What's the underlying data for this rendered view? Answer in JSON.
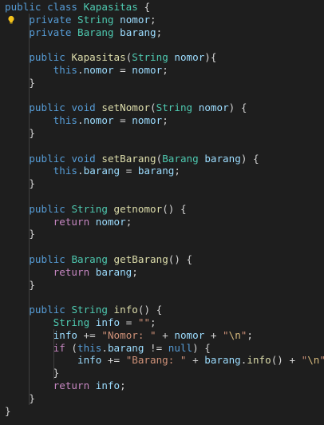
{
  "editor": {
    "background": "#1e1e1e",
    "lightbulb_icon": "lightbulb-icon",
    "lines": [
      [
        [
          "kw",
          "public"
        ],
        [
          "punc",
          " "
        ],
        [
          "kw",
          "class"
        ],
        [
          "punc",
          " "
        ],
        [
          "type",
          "Kapasitas"
        ],
        [
          "punc",
          " {"
        ]
      ],
      [
        [
          "punc",
          "    "
        ],
        [
          "kw",
          "private"
        ],
        [
          "punc",
          " "
        ],
        [
          "type",
          "String"
        ],
        [
          "punc",
          " "
        ],
        [
          "var",
          "nomor"
        ],
        [
          "punc",
          ";"
        ]
      ],
      [
        [
          "punc",
          "    "
        ],
        [
          "kw",
          "private"
        ],
        [
          "punc",
          " "
        ],
        [
          "type",
          "Barang"
        ],
        [
          "punc",
          " "
        ],
        [
          "var",
          "barang"
        ],
        [
          "punc",
          ";"
        ]
      ],
      [],
      [
        [
          "punc",
          "    "
        ],
        [
          "kw",
          "public"
        ],
        [
          "punc",
          " "
        ],
        [
          "fn",
          "Kapasitas"
        ],
        [
          "punc",
          "("
        ],
        [
          "type",
          "String"
        ],
        [
          "punc",
          " "
        ],
        [
          "var",
          "nomor"
        ],
        [
          "punc",
          "){"
        ]
      ],
      [
        [
          "punc",
          "        "
        ],
        [
          "kw",
          "this"
        ],
        [
          "punc",
          "."
        ],
        [
          "var",
          "nomor"
        ],
        [
          "punc",
          " = "
        ],
        [
          "var",
          "nomor"
        ],
        [
          "punc",
          ";"
        ]
      ],
      [
        [
          "punc",
          "    }"
        ]
      ],
      [],
      [
        [
          "punc",
          "    "
        ],
        [
          "kw",
          "public"
        ],
        [
          "punc",
          " "
        ],
        [
          "kw",
          "void"
        ],
        [
          "punc",
          " "
        ],
        [
          "fn",
          "setNomor"
        ],
        [
          "punc",
          "("
        ],
        [
          "type",
          "String"
        ],
        [
          "punc",
          " "
        ],
        [
          "var",
          "nomor"
        ],
        [
          "punc",
          ") {"
        ]
      ],
      [
        [
          "punc",
          "        "
        ],
        [
          "kw",
          "this"
        ],
        [
          "punc",
          "."
        ],
        [
          "var",
          "nomor"
        ],
        [
          "punc",
          " = "
        ],
        [
          "var",
          "nomor"
        ],
        [
          "punc",
          ";"
        ]
      ],
      [
        [
          "punc",
          "    }"
        ]
      ],
      [],
      [
        [
          "punc",
          "    "
        ],
        [
          "kw",
          "public"
        ],
        [
          "punc",
          " "
        ],
        [
          "kw",
          "void"
        ],
        [
          "punc",
          " "
        ],
        [
          "fn",
          "setBarang"
        ],
        [
          "punc",
          "("
        ],
        [
          "type",
          "Barang"
        ],
        [
          "punc",
          " "
        ],
        [
          "var",
          "barang"
        ],
        [
          "punc",
          ") {"
        ]
      ],
      [
        [
          "punc",
          "        "
        ],
        [
          "kw",
          "this"
        ],
        [
          "punc",
          "."
        ],
        [
          "var",
          "barang"
        ],
        [
          "punc",
          " = "
        ],
        [
          "var",
          "barang"
        ],
        [
          "punc",
          ";"
        ]
      ],
      [
        [
          "punc",
          "    }"
        ]
      ],
      [],
      [
        [
          "punc",
          "    "
        ],
        [
          "kw",
          "public"
        ],
        [
          "punc",
          " "
        ],
        [
          "type",
          "String"
        ],
        [
          "punc",
          " "
        ],
        [
          "fn",
          "getnomor"
        ],
        [
          "punc",
          "() {"
        ]
      ],
      [
        [
          "punc",
          "        "
        ],
        [
          "ctrl",
          "return"
        ],
        [
          "punc",
          " "
        ],
        [
          "var",
          "nomor"
        ],
        [
          "punc",
          ";"
        ]
      ],
      [
        [
          "punc",
          "    }"
        ]
      ],
      [],
      [
        [
          "punc",
          "    "
        ],
        [
          "kw",
          "public"
        ],
        [
          "punc",
          " "
        ],
        [
          "type",
          "Barang"
        ],
        [
          "punc",
          " "
        ],
        [
          "fn",
          "getBarang"
        ],
        [
          "punc",
          "() {"
        ]
      ],
      [
        [
          "punc",
          "        "
        ],
        [
          "ctrl",
          "return"
        ],
        [
          "punc",
          " "
        ],
        [
          "var",
          "barang"
        ],
        [
          "punc",
          ";"
        ]
      ],
      [
        [
          "punc",
          "    }"
        ]
      ],
      [],
      [
        [
          "punc",
          "    "
        ],
        [
          "kw",
          "public"
        ],
        [
          "punc",
          " "
        ],
        [
          "type",
          "String"
        ],
        [
          "punc",
          " "
        ],
        [
          "fn",
          "info"
        ],
        [
          "punc",
          "() {"
        ]
      ],
      [
        [
          "punc",
          "        "
        ],
        [
          "type",
          "String"
        ],
        [
          "punc",
          " "
        ],
        [
          "var",
          "info"
        ],
        [
          "punc",
          " = "
        ],
        [
          "str",
          "\"\""
        ],
        [
          "punc",
          ";"
        ]
      ],
      [
        [
          "punc",
          "        "
        ],
        [
          "var",
          "info"
        ],
        [
          "punc",
          " += "
        ],
        [
          "str",
          "\"Nomor: \""
        ],
        [
          "punc",
          " + "
        ],
        [
          "var",
          "nomor"
        ],
        [
          "punc",
          " + "
        ],
        [
          "str",
          "\""
        ],
        [
          "esc",
          "\\n"
        ],
        [
          "str",
          "\""
        ],
        [
          "punc",
          ";"
        ]
      ],
      [
        [
          "punc",
          "        "
        ],
        [
          "ctrl",
          "if"
        ],
        [
          "punc",
          " ("
        ],
        [
          "kw",
          "this"
        ],
        [
          "punc",
          "."
        ],
        [
          "var",
          "barang"
        ],
        [
          "punc",
          " != "
        ],
        [
          "kw",
          "null"
        ],
        [
          "punc",
          ") {"
        ]
      ],
      [
        [
          "punc",
          "            "
        ],
        [
          "var",
          "info"
        ],
        [
          "punc",
          " += "
        ],
        [
          "str",
          "\"Barang: \""
        ],
        [
          "punc",
          " + "
        ],
        [
          "var",
          "barang"
        ],
        [
          "punc",
          "."
        ],
        [
          "fn",
          "info"
        ],
        [
          "punc",
          "() + "
        ],
        [
          "str",
          "\""
        ],
        [
          "esc",
          "\\n"
        ],
        [
          "str",
          "\""
        ],
        [
          "punc",
          ";"
        ]
      ],
      [
        [
          "punc",
          "        }"
        ]
      ],
      [
        [
          "punc",
          "        "
        ],
        [
          "ctrl",
          "return"
        ],
        [
          "punc",
          " "
        ],
        [
          "var",
          "info"
        ],
        [
          "punc",
          ";"
        ]
      ],
      [
        [
          "punc",
          "    }"
        ]
      ],
      [
        [
          "punc",
          "}"
        ]
      ]
    ]
  }
}
